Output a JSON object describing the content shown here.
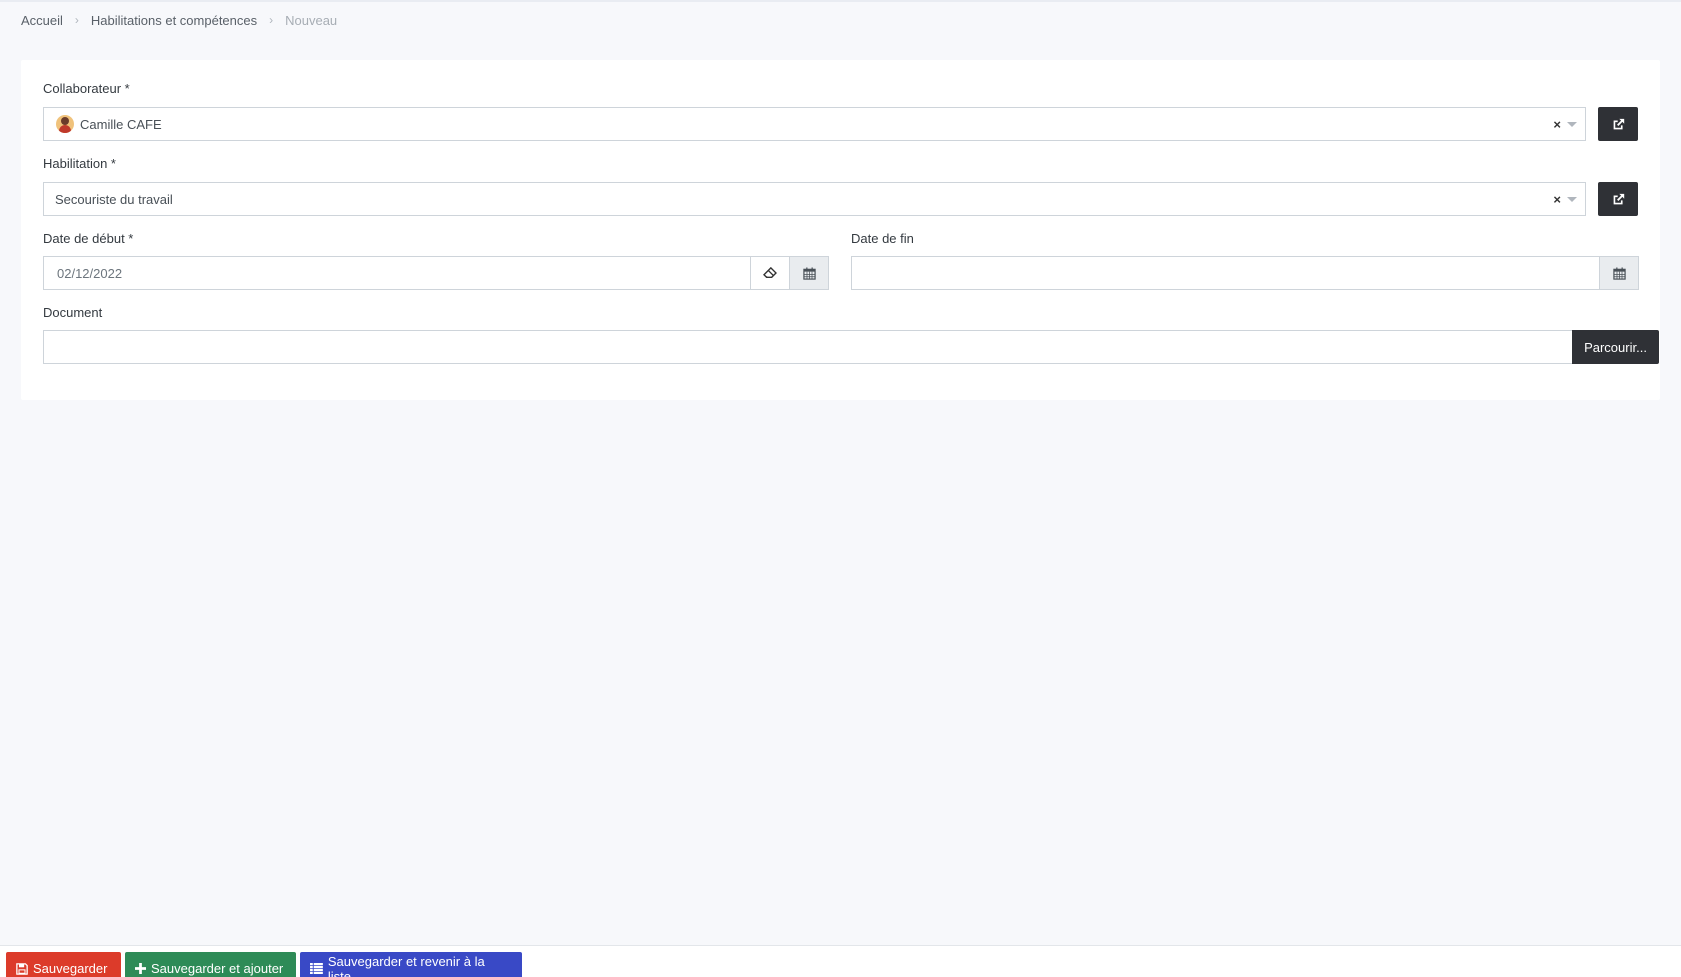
{
  "breadcrumb": {
    "items": [
      "Accueil",
      "Habilitations et compétences"
    ],
    "current": "Nouveau"
  },
  "form": {
    "collaborateur": {
      "label": "Collaborateur *",
      "value": "Camille CAFE"
    },
    "habilitation": {
      "label": "Habilitation *",
      "value": "Secouriste du travail"
    },
    "date_debut": {
      "label": "Date de début *",
      "value": "02/12/2022"
    },
    "date_fin": {
      "label": "Date de fin",
      "value": ""
    },
    "document": {
      "label": "Document",
      "value": "",
      "browse_label": "Parcourir..."
    }
  },
  "footer": {
    "save_label": "Sauvegarder",
    "save_add_label": "Sauvegarder et ajouter",
    "save_list_label": "Sauvegarder et revenir à la liste"
  },
  "icons": {
    "clear": "×",
    "breadcrumb_separator": "›"
  },
  "colors": {
    "save": "#dc3b2a",
    "save_add": "#2e8b57",
    "save_list": "#3949c6",
    "dark_button": "#2f3136"
  }
}
